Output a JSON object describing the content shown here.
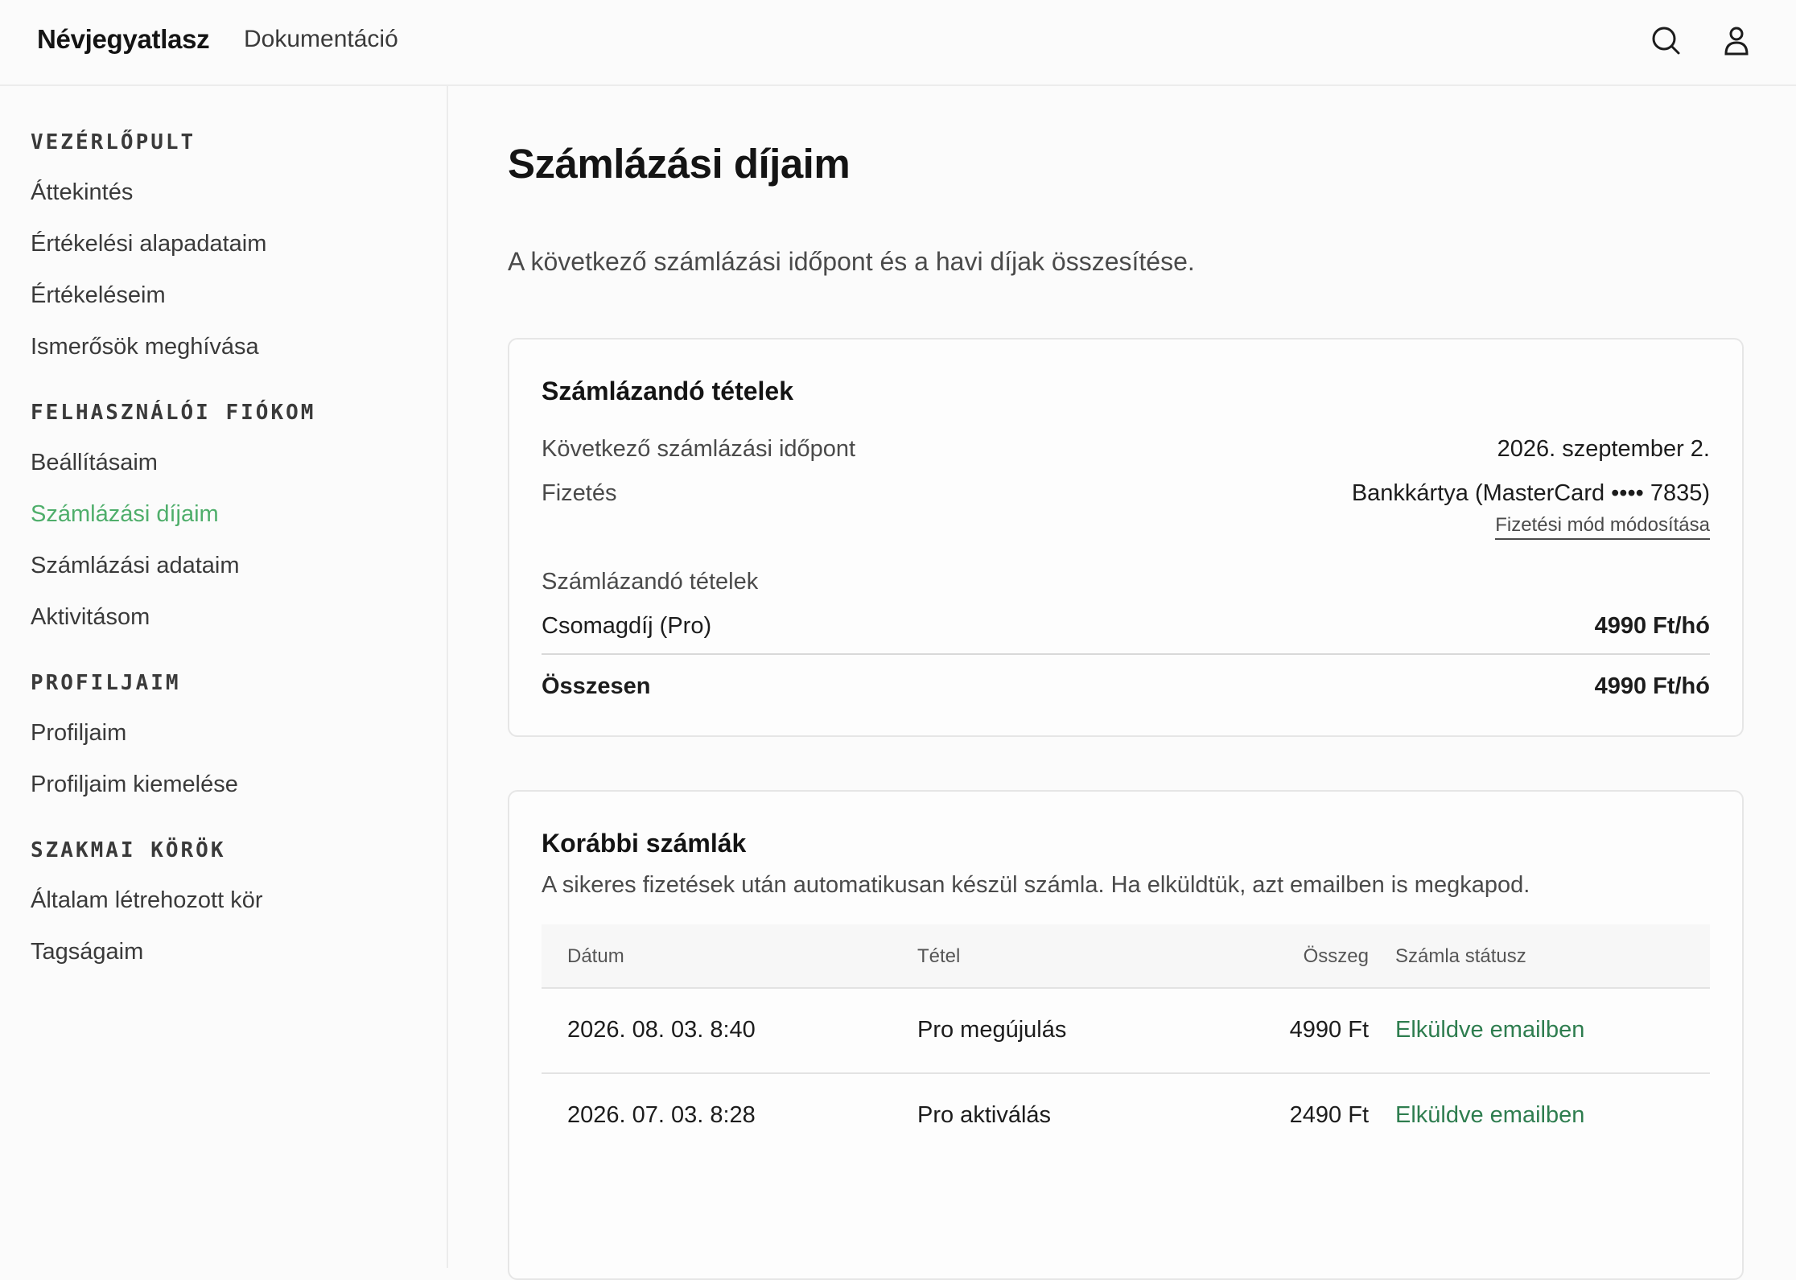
{
  "header": {
    "brand": "Névjegyatlasz",
    "docs_link": "Dokumentáció",
    "search_icon": "search-icon",
    "user_icon": "user-icon"
  },
  "sidebar": {
    "sections": [
      {
        "title": "VEZÉRLŐPULT",
        "items": [
          "Áttekintés",
          "Értékelési alapadataim",
          "Értékeléseim",
          "Ismerősök meghívása"
        ]
      },
      {
        "title": "FELHASZNÁLÓI FIÓKOM",
        "items": [
          "Beállításaim",
          "Számlázási díjaim",
          "Számlázási adataim",
          "Aktivitásom"
        ]
      },
      {
        "title": "PROFILJAIM",
        "items": [
          "Profiljaim",
          "Profiljaim kiemelése"
        ]
      },
      {
        "title": "SZAKMAI KÖRÖK",
        "items": [
          "Általam létrehozott kör",
          "Tagságaim"
        ]
      }
    ],
    "active_item": "Számlázási díjaim",
    "active_color": "#4fae6b"
  },
  "main": {
    "title": "Számlázási díjaim",
    "description": "A következő számlázási időpont és a havi díjak összesítése.",
    "billing_card": {
      "title": "Számlázandó tételek",
      "next_billing_label": "Következő számlázási időpont",
      "next_billing_value": "2026. szeptember 2.",
      "payment_label": "Fizetés",
      "payment_value": "Bankkártya (MasterCard •••• 7835)",
      "change_payment_link": "Fizetési mód módosítása",
      "items_label": "Számlázandó tételek",
      "item_name": "Csomagdíj (Pro)",
      "item_price": "4990 Ft/hó",
      "total_label": "Összesen",
      "total_value": "4990 Ft/hó"
    },
    "invoices_card": {
      "title": "Korábbi számlák",
      "description": "A sikeres fizetések után automatikusan készül számla. Ha elküldtük, azt emailben is megkapod.",
      "columns": [
        "Dátum",
        "Tétel",
        "Összeg",
        "Számla státusz"
      ],
      "rows": [
        {
          "date": "2026. 08. 03. 8:40",
          "item": "Pro megújulás",
          "amount": "4990 Ft",
          "status": "Elküldve emailben"
        },
        {
          "date": "2026. 07. 03. 8:28",
          "item": "Pro aktiválás",
          "amount": "2490 Ft",
          "status": "Elküldve emailben"
        }
      ],
      "status_color": "#2e7d4f"
    }
  }
}
